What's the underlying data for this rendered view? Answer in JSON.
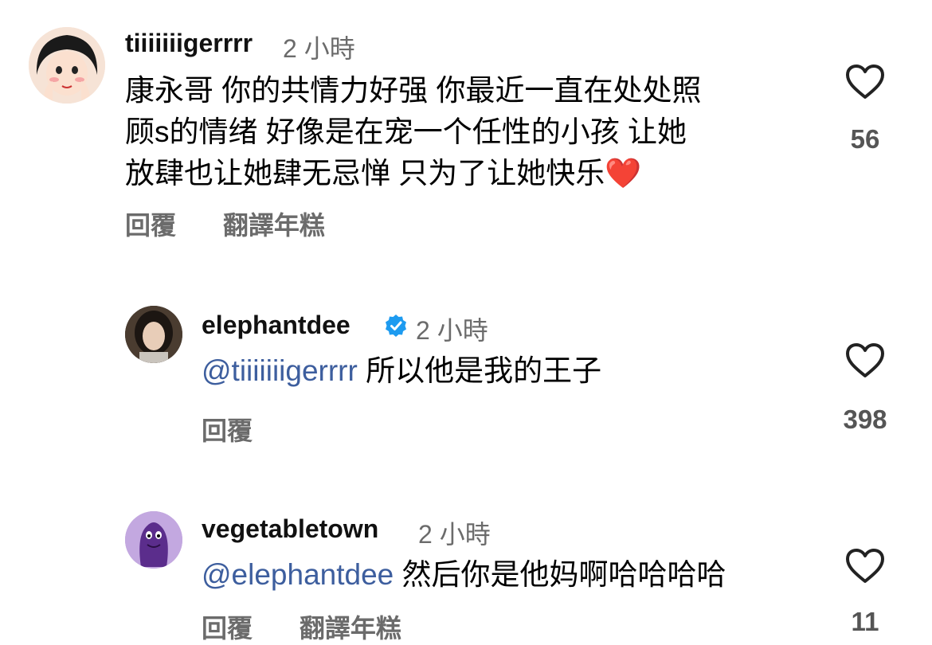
{
  "comments": [
    {
      "username": "tiiiiiiigerrrr",
      "time": "2 小時",
      "text_lines": [
        "康永哥 你的共情力好强 你最近一直在处处照",
        "顾s的情绪 好像是在宠一个任性的小孩 让她",
        "放肆也让她肆无忌惮 只为了让她快乐"
      ],
      "emoji": "❤️",
      "reply": "回覆",
      "translate": "翻譯年糕",
      "likes": "56"
    },
    {
      "username": "elephantdee",
      "verified": true,
      "time": "2 小時",
      "mention": "@tiiiiiiigerrrr",
      "text": " 所以他是我的王子",
      "reply": "回覆",
      "likes": "398"
    },
    {
      "username": "vegetabletown",
      "time": "2 小時",
      "mention": "@elephantdee",
      "text": " 然后你是他妈啊哈哈哈哈",
      "reply": "回覆",
      "translate": "翻譯年糕",
      "likes": "11"
    }
  ],
  "colors": {
    "mention": "#3d5e9e",
    "secondary": "#6b6b6b",
    "verified": "#1d9bf0"
  },
  "icons": [
    "heart-icon",
    "verified-badge-icon"
  ]
}
